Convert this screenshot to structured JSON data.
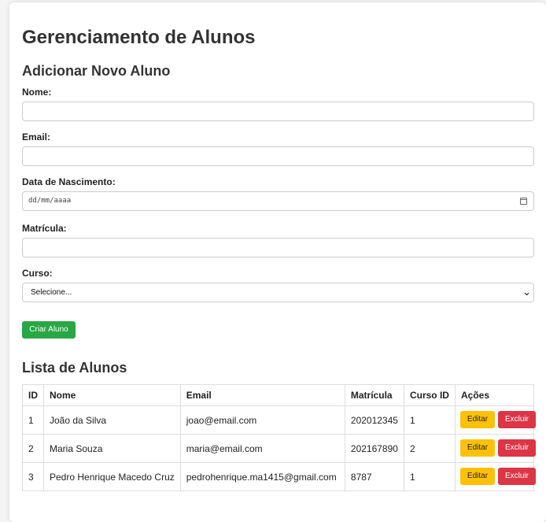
{
  "page": {
    "title": "Gerenciamento de Alunos",
    "form_title": "Adicionar Novo Aluno",
    "list_title": "Lista de Alunos"
  },
  "form": {
    "nome_label": "Nome:",
    "nome_value": "",
    "email_label": "Email:",
    "email_value": "",
    "nascimento_label": "Data de Nascimento:",
    "nascimento_placeholder": "dd/mm/aaaa",
    "matricula_label": "Matrícula:",
    "matricula_value": "",
    "curso_label": "Curso:",
    "curso_selected": "Selecione...",
    "submit_label": "Criar Aluno"
  },
  "table": {
    "headers": [
      "ID",
      "Nome",
      "Email",
      "Matrícula",
      "Curso ID",
      "Ações"
    ],
    "rows": [
      {
        "id": "1",
        "nome": "João da Silva",
        "email": "joao@email.com",
        "matricula": "202012345",
        "curso_id": "1"
      },
      {
        "id": "2",
        "nome": "Maria Souza",
        "email": "maria@email.com",
        "matricula": "202167890",
        "curso_id": "2"
      },
      {
        "id": "3",
        "nome": "Pedro Henrique Macedo Cruz",
        "email": "pedrohenrique.ma1415@gmail.com",
        "matricula": "8787",
        "curso_id": "1"
      }
    ],
    "edit_label": "Editar",
    "delete_label": "Excluir"
  },
  "colors": {
    "primary_button": "#28a745",
    "edit_button": "#ffc107",
    "delete_button": "#dc3545"
  },
  "icons": {
    "date_picker": "calendar-icon",
    "select": "chevron-down-icon"
  }
}
